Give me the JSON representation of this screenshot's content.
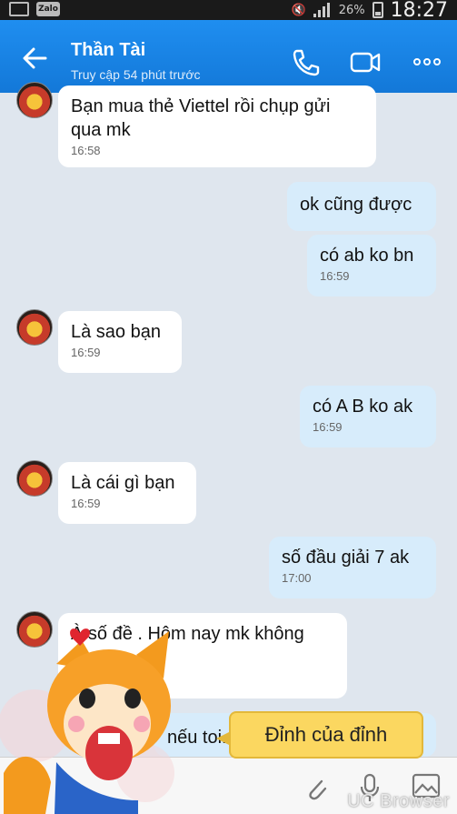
{
  "statusbar": {
    "battery": "26%",
    "time": "18:27",
    "app_badge": "Zalo"
  },
  "header": {
    "title": "Thần Tài",
    "subtitle": "Truy cập 54 phút trước"
  },
  "messages": [
    {
      "text_line1": "Bạn mua thẻ Viettel rồi chụp gửi",
      "text_line2": "qua mk",
      "time": "16:58"
    },
    {
      "text": "ok cũng được"
    },
    {
      "text": "có ab ko bn",
      "time": "16:59"
    },
    {
      "text": "Là sao bạn",
      "time": "16:59"
    },
    {
      "text": "có A B ko ak",
      "time": "16:59"
    },
    {
      "text": "Là cái gì bạn",
      "time": "16:59"
    },
    {
      "text": "số đầu giải 7 ak",
      "time": "17:00"
    },
    {
      "text_line1": "À số đề . Hôm nay mk không"
    },
    {
      "text": "nếu toi..."
    }
  ],
  "overlay": {
    "tooltip": "Đỉnh của đỉnh",
    "watermark": "UC Browser"
  },
  "colors": {
    "header": "#1e88e5",
    "mine_bubble": "#d7ecfb",
    "other_bubble": "#ffffff",
    "background": "#dfe6ee"
  }
}
